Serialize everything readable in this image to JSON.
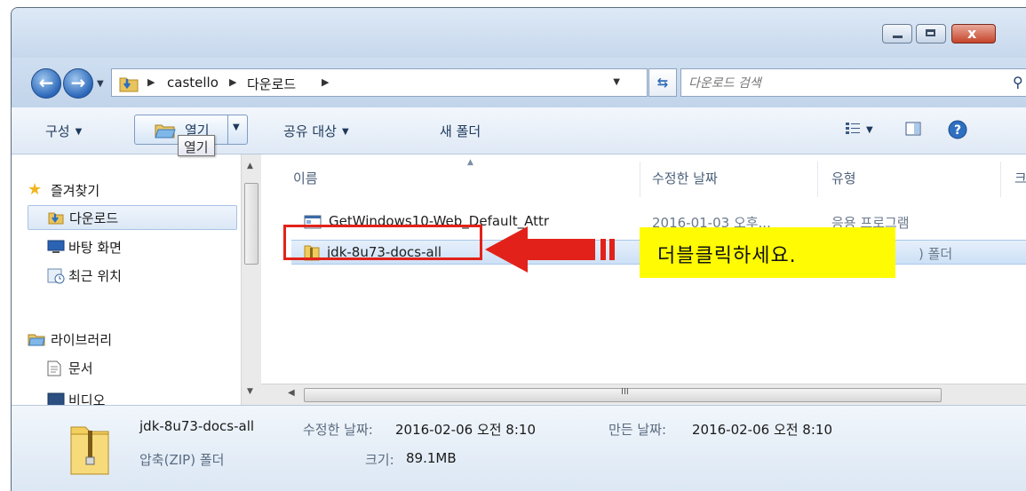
{
  "window": {
    "close_label": "x"
  },
  "address": {
    "crumbs": [
      "castello",
      "다운로드"
    ]
  },
  "search": {
    "placeholder": "다운로드 검색"
  },
  "toolbar": {
    "organize": "구성",
    "open": "열기",
    "share": "공유 대상",
    "new_folder": "새 폴더",
    "open_tooltip": "열기"
  },
  "nav": {
    "favorites": "즐겨찾기",
    "downloads": "다운로드",
    "desktop": "바탕 화면",
    "recent": "최근 위치",
    "libraries": "라이브러리",
    "documents": "문서",
    "videos": "비디오"
  },
  "columns": {
    "name": "이름",
    "modified": "수정한 날짜",
    "type": "유형",
    "size": "크"
  },
  "files": [
    {
      "name": "GetWindows10-Web_Default_Attr",
      "modified": "2016-01-03 오후...",
      "type": "응용 프로그램"
    },
    {
      "name": "jdk-8u73-docs-all",
      "modified": "",
      "type": ") 폴더"
    }
  ],
  "annotation": {
    "label": "더블클릭하세요.",
    "arrow_color": "#e2221a",
    "highlight_color": "#fffb03"
  },
  "details": {
    "name": "jdk-8u73-docs-all",
    "modified_label": "수정한 날짜:",
    "modified_value": "2016-02-06 오전 8:10",
    "created_label": "만든 날짜:",
    "created_value": "2016-02-06 오전 8:10",
    "type": "압축(ZIP) 폴더",
    "size_label": "크기:",
    "size_value": "89.1MB"
  },
  "scroll": {
    "grip": "III"
  }
}
